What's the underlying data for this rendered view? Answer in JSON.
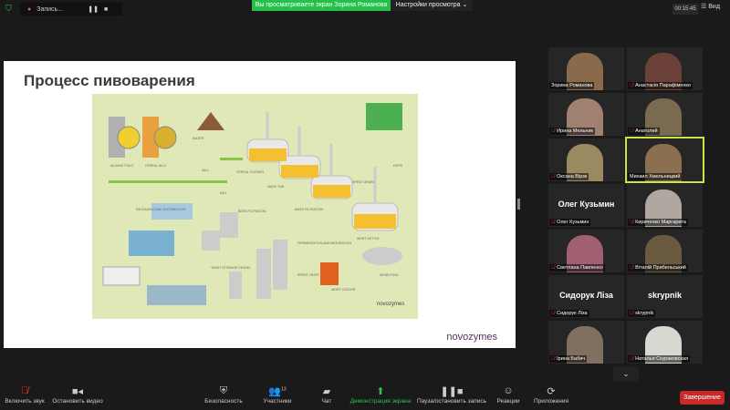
{
  "topbar": {
    "recording_label": "Запись...",
    "banner": "Вы просматриваете экран Зорина Романова",
    "view_options": "Настройки просмотра ⌄",
    "timer": "00:15:45",
    "view": "Вид"
  },
  "slide": {
    "title": "Процесс пивоварения",
    "logo": "novozymes",
    "diagram_labels": {
      "adjunct_silo": "ADJUNCT SILO",
      "cereal_silo": "CEREAL SILO",
      "water": "WATER",
      "mill1": "MILL",
      "mill2": "MILL",
      "cereal_cooker": "CEREAL COOKER",
      "mash_tun": "MASH TUN",
      "mash_filtration": "MASH FILTRATION",
      "spent_grain": "SPENT GRAIN",
      "hops": "HOPS",
      "wort_kettle": "WORT KETTLE",
      "whirlpool": "WHIRLPOOL",
      "wort_cooler": "WORT COOLER",
      "fermentation": "FERMENTATION AND MATURATION",
      "spent_yeast": "SPENT YEAST",
      "yeast_storage": "YEAST STORAGE VESSEL",
      "beer_filtration": "BEER FILTRATION",
      "packaging": "PACKAGING AND DISTRIBUTION",
      "diagram_logo": "novozymes"
    }
  },
  "participants": [
    {
      "name": "Зорина Романова",
      "muted": false,
      "color": "#8a6a4a"
    },
    {
      "name": "Анастасія Парафіменко",
      "muted": true,
      "color": "#6a4038"
    },
    {
      "name": "Ирина Мельник",
      "muted": true,
      "color": "#a08070"
    },
    {
      "name": "Анатолий",
      "muted": true,
      "color": "#7a6a50"
    },
    {
      "name": "Оксана Вірзк",
      "muted": true,
      "color": "#9a8a60"
    },
    {
      "name": "Михаил Хмельницкий",
      "muted": false,
      "color": "#8a7050",
      "active": true
    },
    {
      "name": "Олег Кузьмин",
      "muted": true,
      "display": "Олег Кузьмин"
    },
    {
      "name": "Кириченко Маргарита",
      "muted": true,
      "color": "#b0a8a0"
    },
    {
      "name": "Светлана Павленко",
      "muted": true,
      "color": "#a06070"
    },
    {
      "name": "Віталій Прибельський",
      "muted": true,
      "color": "#6a5a40"
    },
    {
      "name": "Сидорук Ліза",
      "muted": true,
      "display": "Сидорук Ліза"
    },
    {
      "name": "skrypnik",
      "muted": true,
      "display": "skrypnik"
    },
    {
      "name": "Ірина Бабич",
      "muted": true,
      "color": "#807060"
    },
    {
      "name": "Наталья Скураковская",
      "muted": true,
      "color": "#d8d8d0"
    }
  ],
  "toolbar": {
    "unmute": "Включить звук",
    "stop_video": "Остановить видео",
    "security": "Безопасность",
    "participants": "Участники",
    "participants_count": "13",
    "chat": "Чат",
    "share": "Демонстрация экрана",
    "record": "Пауза/остановить запись",
    "reactions": "Реакции",
    "apps": "Приложения",
    "end": "Завершение"
  }
}
